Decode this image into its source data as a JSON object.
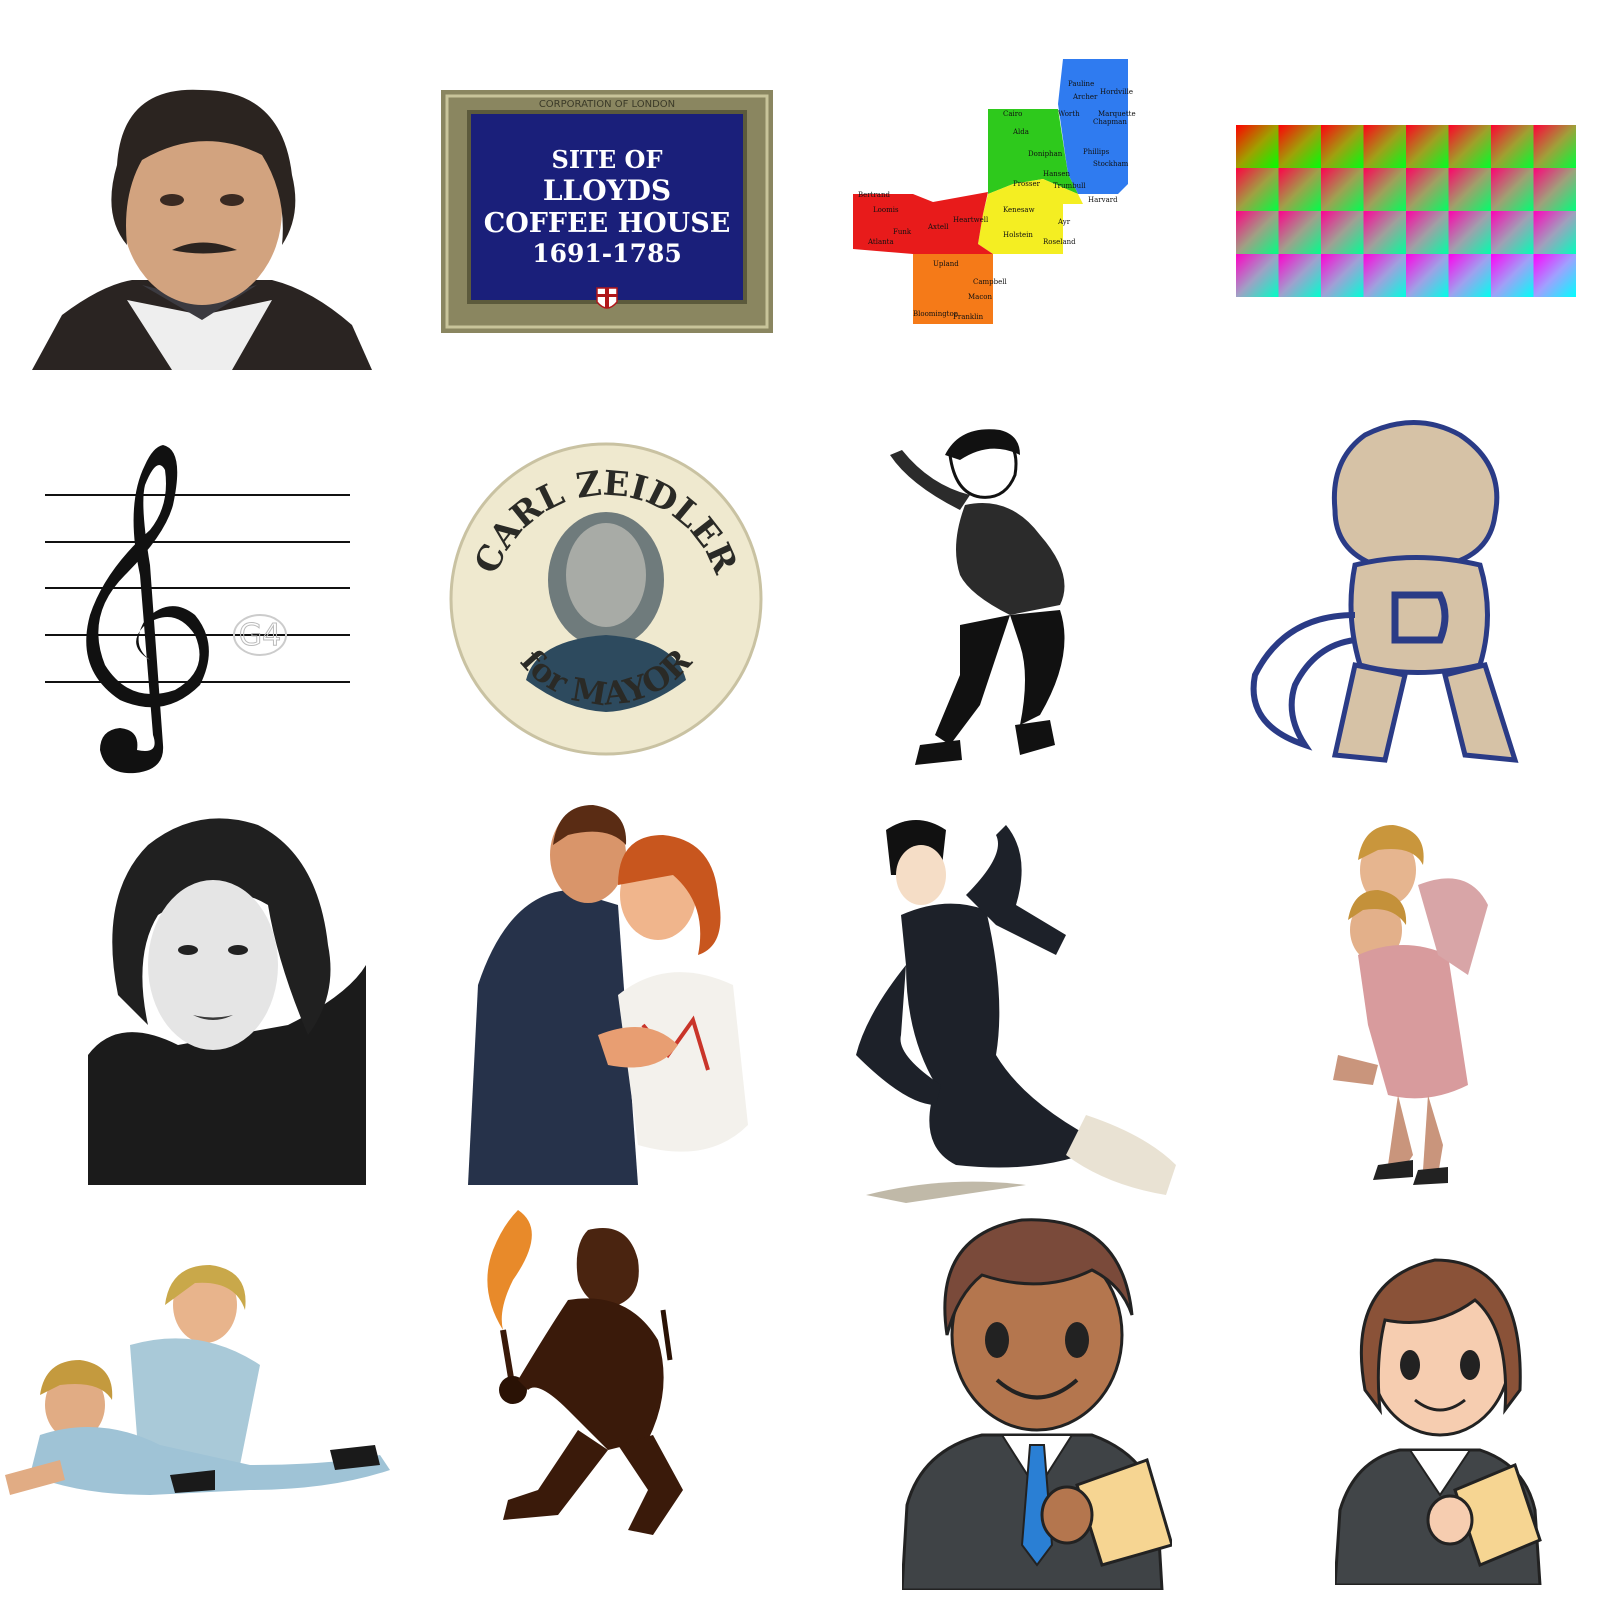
{
  "plaque": {
    "header": "CORPORATION OF LONDON",
    "line1": "SITE OF",
    "line2": "LLOYDS",
    "line3": "COFFEE HOUSE",
    "line4": "1691-1785",
    "background_color": "#1a1f7a",
    "frame_color": "#8a8660"
  },
  "county_map": {
    "colors": [
      "#2f7bf0",
      "#2ec91c",
      "#f4ee22",
      "#e81b1b",
      "#f57a18"
    ],
    "places": [
      "Pauline",
      "Archer",
      "Hordville",
      "Worth",
      "Marquette",
      "Chapman",
      "Cairo",
      "Alda",
      "Phillips",
      "Doniphan",
      "Stockham",
      "Hansen",
      "Prosser",
      "Trumbull",
      "Harvard",
      "Kenesaw",
      "Ayr",
      "Holstein",
      "Roseland",
      "Heartwell",
      "Axtell",
      "Funk",
      "Atlanta",
      "Loomis",
      "Bertrand",
      "Upland",
      "Campbell",
      "Macon",
      "Bloomington",
      "Franklin"
    ]
  },
  "treble_clef": {
    "note_label": "G4"
  },
  "campaign_button": {
    "top_text": "CARL ZEIDLER",
    "bottom_text": "for MAYOR"
  },
  "color_grid": {
    "rows": 4,
    "cols": 8
  }
}
